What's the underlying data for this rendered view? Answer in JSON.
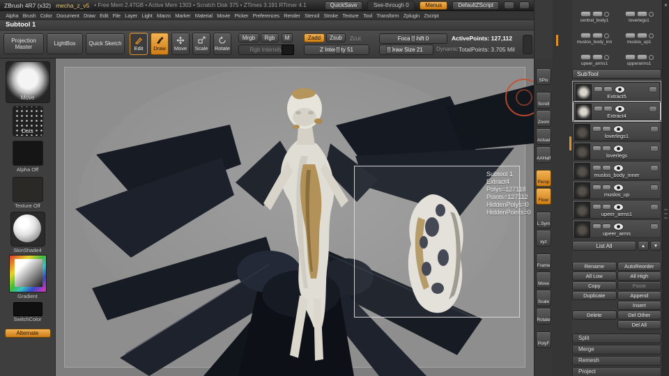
{
  "colors": {
    "accent": "#e09228",
    "canvas": "#8e8e8e",
    "dark_mesh": "#171b23",
    "white_mesh": "#e0ddd4",
    "gold": "#b29258"
  },
  "titlebar": {
    "app_title": "ZBrush 4R7 (x32)",
    "doc_name": "mecha_z_v5",
    "stats": "• Free Mem 2.47GB • Active Mem 1303 • Scratch Disk 375 • ZTimes 3.191 RTimer 4.1",
    "quicksave": "QuickSave",
    "see_through": "See-through 0",
    "menus": "Menus",
    "zscript": "DefaultZScript",
    "close": "×"
  },
  "menubar": {
    "items": [
      "Alpha",
      "Brush",
      "Color",
      "Document",
      "Draw",
      "Edit",
      "File",
      "Layer",
      "Light",
      "Macro",
      "Marker",
      "Material",
      "Movie",
      "Picker",
      "Preferences",
      "Render",
      "Stencil",
      "Stroke",
      "Texture",
      "Tool",
      "Transform",
      "Zplugin",
      "Zscript"
    ]
  },
  "toolrow": {
    "label": "Subtool 1"
  },
  "shelf": {
    "projection_master": "Projection Master",
    "lightbox": "LightBox",
    "quick_sketch": "Quick Sketch",
    "edit": "Edit",
    "draw": "Draw",
    "move": "Move",
    "scale": "Scale",
    "rotate": "Rotate",
    "mrgb": "Mrgb",
    "rgb": "Rgb",
    "m": "M",
    "rgb_intensity": "Rgb Intensity",
    "zadd": "Zadd",
    "zsub": "Zsub",
    "zcut": "Zcut",
    "z_intensity": "Z Intensity 51",
    "focal_shift": "Focal Shift 0",
    "draw_size": "Draw Size 21",
    "dynamic": "Dynamic",
    "active_points": "ActivePoints: 127,112",
    "total_points": "TotalPoints: 3.705 Mil"
  },
  "left_shelf": {
    "brush": "Move",
    "stroke": "Dots",
    "alpha": "Alpha Off",
    "texture": "Texture Off",
    "material": "SkinShade4",
    "picker": "Gradient",
    "switch_color": "SwitchColor",
    "alternate": "Alternate"
  },
  "canvas": {
    "overlay": [
      "Subtool 1",
      "Extract4",
      "Polys=127118",
      "Points=127112",
      "HiddenPolys=0",
      "HiddenPoints=0"
    ]
  },
  "rail": {
    "items": [
      "SPix",
      "Scroll",
      "Zoom",
      "Actual",
      "AAHalf",
      "Persp",
      "Floor",
      "L.Sym",
      "xyz",
      "Frame",
      "Move",
      "Scale",
      "Rotate",
      "PolyF"
    ]
  },
  "right_panel": {
    "quick_picks": [
      "central_body1",
      "loverlegs1",
      "muslos_body_inn",
      "muslos_up1",
      "upeer_arms1",
      "upperarms1"
    ],
    "subtool_header": "SubTool",
    "subtools": [
      "Extract5",
      "Extract4",
      "loverlegs1",
      "loverlegs",
      "muslos_body_inner",
      "muslos_up",
      "upeer_arms1",
      "upeer_arms"
    ],
    "list_all": "List All",
    "up": "▲",
    "down": "▼",
    "buttons": {
      "rename": "Rename",
      "autoreorder": "AutoReorder",
      "all_low": "All Low",
      "all_high": "All High",
      "copy": "Copy",
      "paste": "Paste",
      "duplicate": "Duplicate",
      "append": "Append",
      "insert": "Insert",
      "delete": "Delete",
      "del_other": "Del Other",
      "del_all": "Del All"
    },
    "sections": [
      "Split",
      "Merge",
      "Remesh",
      "Project"
    ]
  }
}
